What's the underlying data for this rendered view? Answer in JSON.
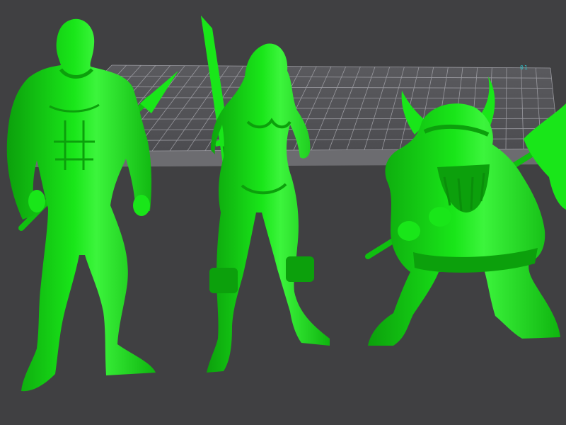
{
  "viewport": {
    "background_color": "#404042",
    "plate_label": "01"
  },
  "colors": {
    "model_green": "#19e619",
    "model_shadow": "#0ca00c",
    "model_highlight": "#5cff5c",
    "build_plate": "#545457",
    "build_plate_grid": "#9a9aa0",
    "build_plate_edge": "#6c6c70",
    "plate_label_color": "#2fc0c6",
    "axis_blue": "#3a52e6"
  },
  "models": [
    {
      "id": "barbarian-warrior",
      "icon": "muscular-warrior-with-spear-figure"
    },
    {
      "id": "barbarian-woman",
      "icon": "female-warrior-with-sword-figure"
    },
    {
      "id": "viking-dwarf",
      "icon": "horned-helmet-dwarf-with-axe-figure"
    }
  ]
}
